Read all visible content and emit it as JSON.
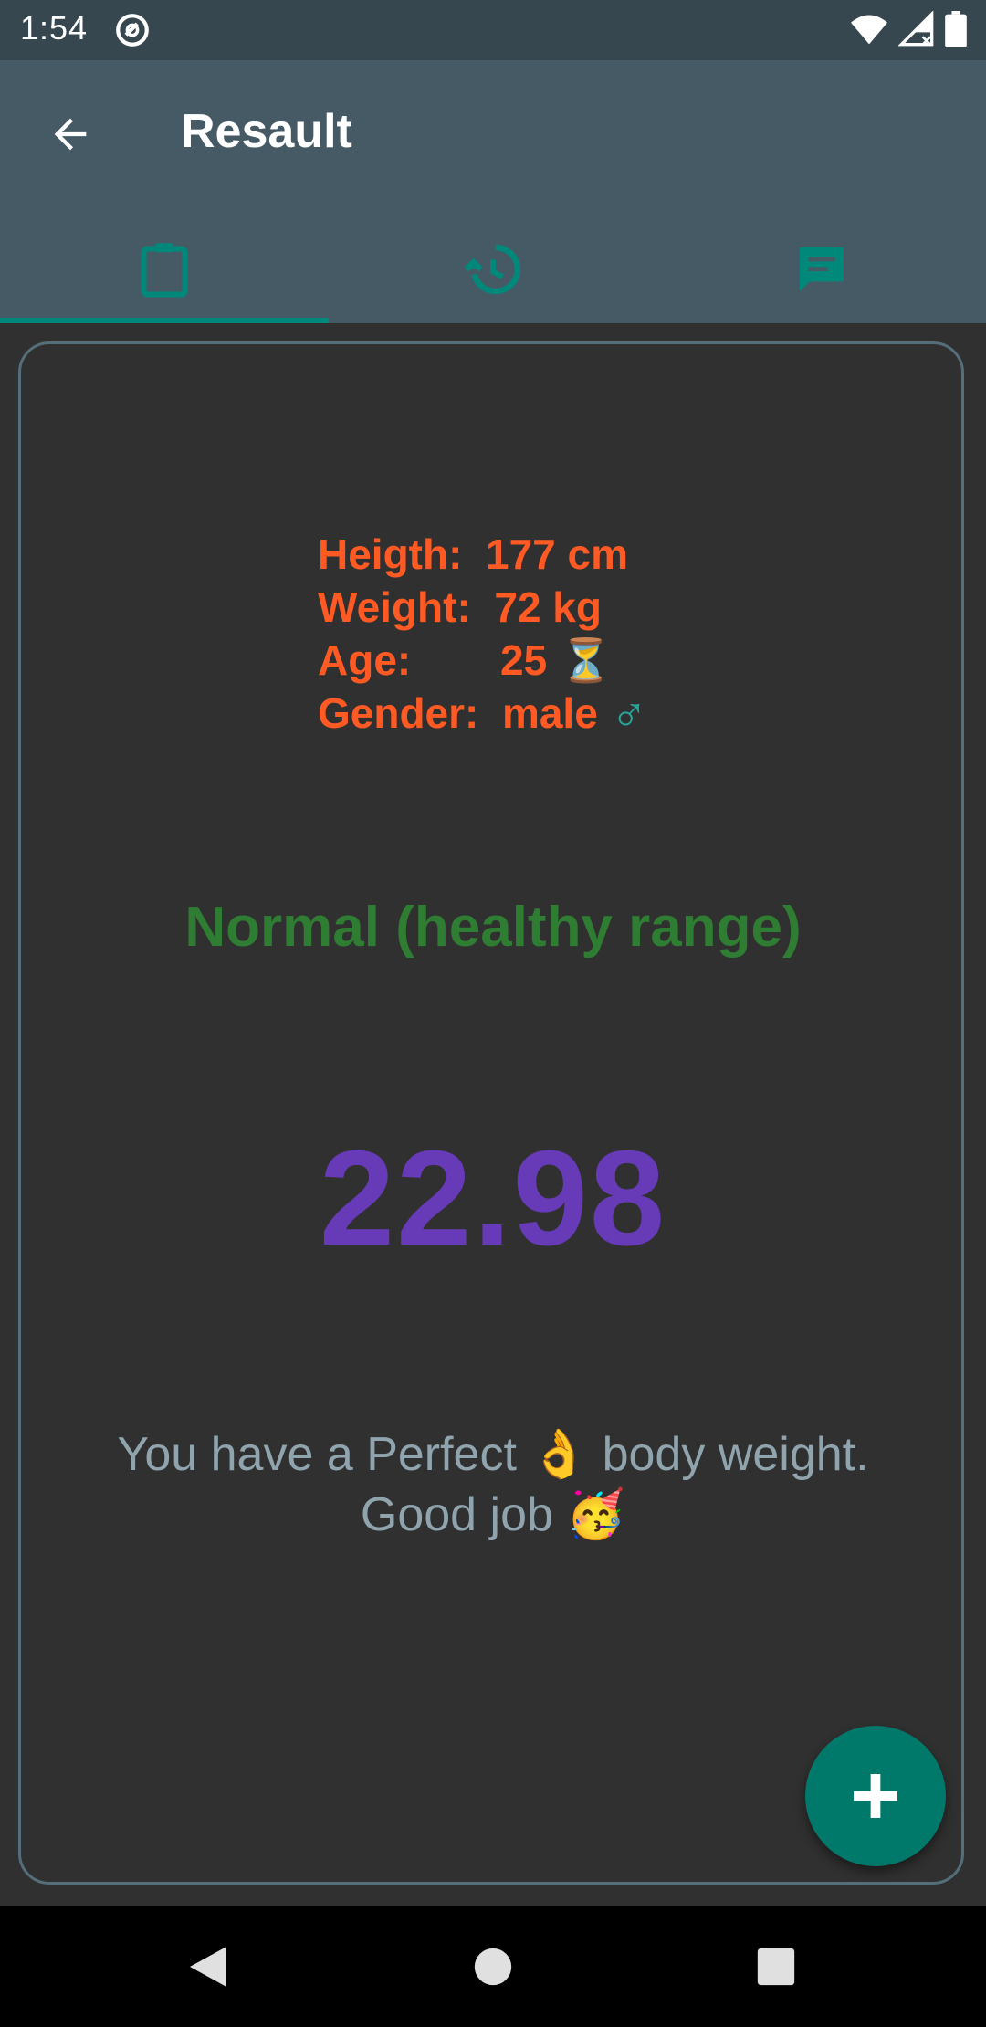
{
  "status_bar": {
    "time": "1:54",
    "icons": [
      "at-sign-icon",
      "wifi-icon",
      "signal-icon",
      "battery-icon"
    ]
  },
  "app_bar": {
    "title": "Resault",
    "back_icon": "arrow-back-icon",
    "tabs": [
      {
        "icon": "clipboard-icon",
        "selected": true
      },
      {
        "icon": "history-icon",
        "selected": false
      },
      {
        "icon": "chat-icon",
        "selected": false
      }
    ],
    "accent_color": "#00897b"
  },
  "result": {
    "height_label": "Heigth:",
    "height_value": "177 cm",
    "weight_label": "Weight:",
    "weight_value": "72 kg",
    "age_label": "Age:",
    "age_value": "25",
    "age_emoji": "⏳",
    "gender_label": "Gender:",
    "gender_value": "male",
    "gender_emoji": "♂",
    "category": "Normal (healthy range)",
    "bmi": "22.98",
    "message_line1_a": "You have a Perfect",
    "message_emoji1": "👌",
    "message_line1_b": "body weight.",
    "message_line2": "Good job",
    "message_emoji2": "🥳"
  },
  "fab": {
    "icon": "plus-icon"
  },
  "nav_bar": {
    "icons": [
      "nav-back-icon",
      "nav-home-icon",
      "nav-recents-icon"
    ]
  },
  "colors": {
    "info_text": "#ff5a24",
    "category_text": "#2e7d32",
    "bmi_text": "#673ab7",
    "message_text": "#90a4ae",
    "fab": "#00796b"
  }
}
